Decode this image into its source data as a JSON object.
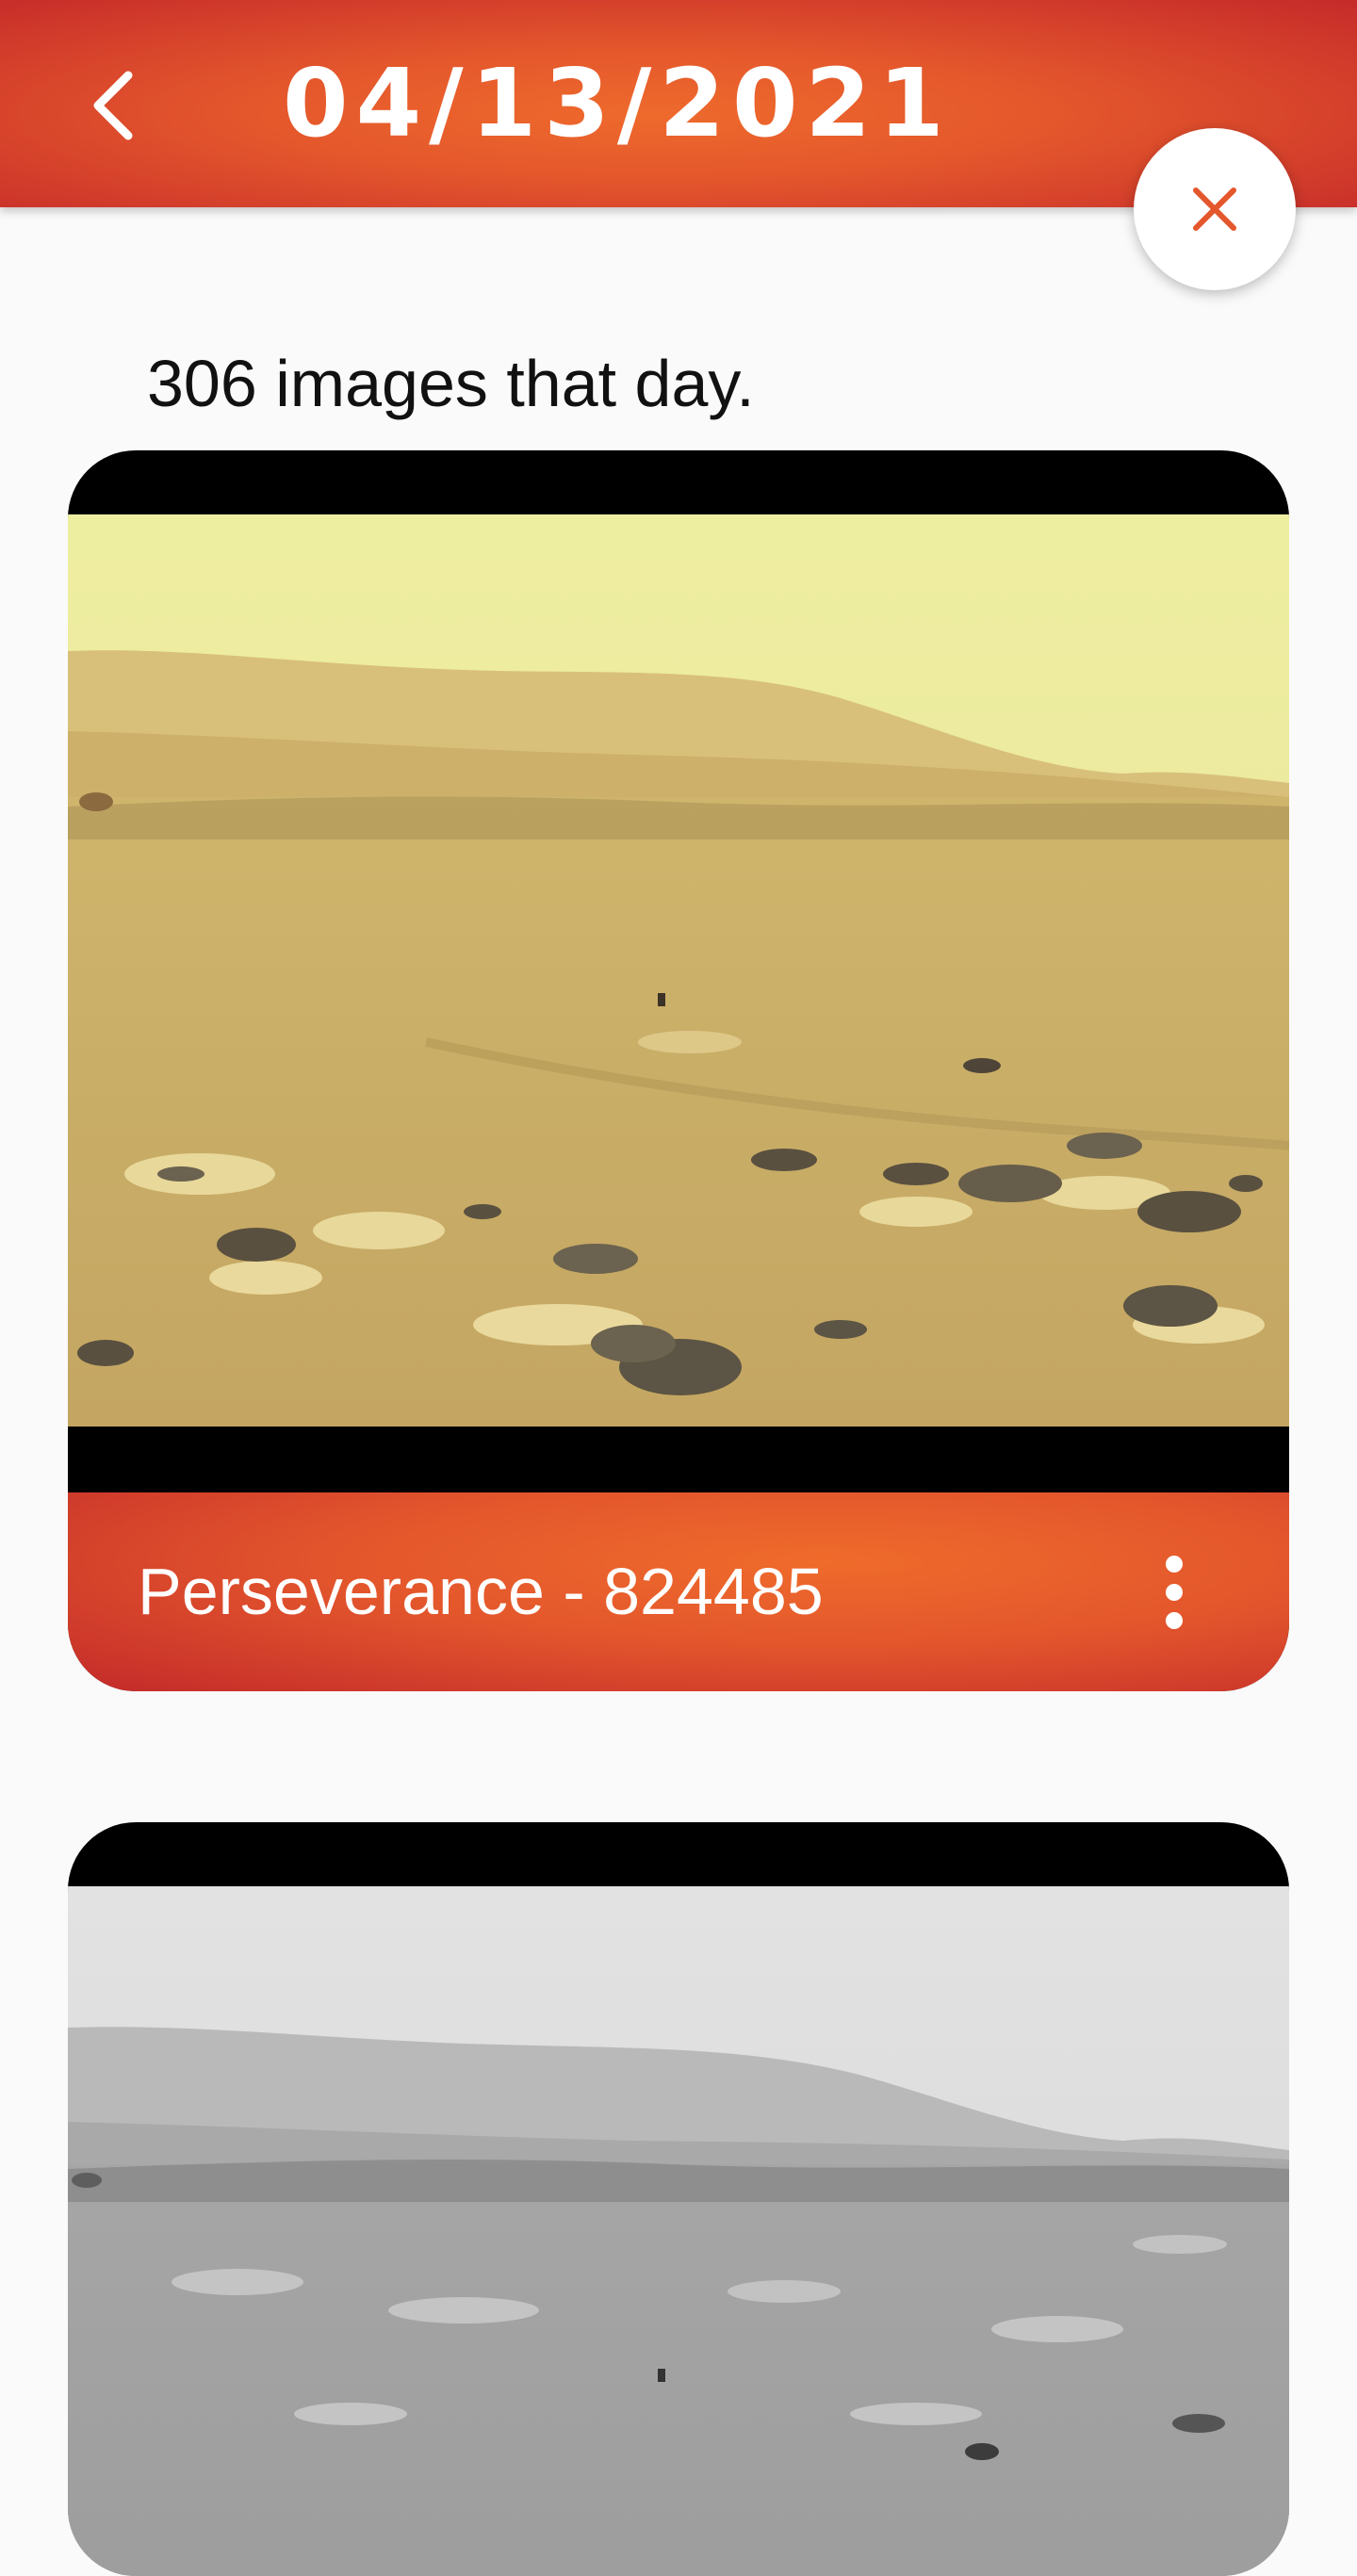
{
  "header": {
    "title": "04/13/2021",
    "back_icon": "chevron-left-icon",
    "background_colors": [
      "#ee6a2c",
      "#c52a2a"
    ]
  },
  "close_button": {
    "icon": "close-icon",
    "icon_color": "#e4572c"
  },
  "summary": {
    "count_text": "306 images that day."
  },
  "photos": [
    {
      "label": "Perseverance - 824485",
      "image": "mars-landscape-color",
      "menu_icon": "more-vert-icon"
    },
    {
      "image": "mars-landscape-grayscale"
    }
  ],
  "colors": {
    "accent": "#e4572c",
    "accent_dark": "#c52a2a",
    "background": "#fafafa"
  }
}
